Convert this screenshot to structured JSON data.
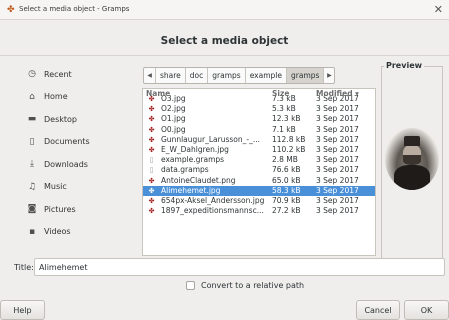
{
  "window": {
    "title": "Select a media object - Gramps",
    "heading": "Select a media object"
  },
  "sidebar": {
    "items": [
      {
        "label": "Recent",
        "icon": "clock-icon"
      },
      {
        "label": "Home",
        "icon": "home-icon"
      },
      {
        "label": "Desktop",
        "icon": "folder-icon"
      },
      {
        "label": "Documents",
        "icon": "document-icon"
      },
      {
        "label": "Downloads",
        "icon": "download-icon"
      },
      {
        "label": "Music",
        "icon": "music-icon"
      },
      {
        "label": "Pictures",
        "icon": "camera-icon"
      },
      {
        "label": "Videos",
        "icon": "video-icon"
      }
    ]
  },
  "pathbar": {
    "crumbs": [
      "share",
      "doc",
      "gramps",
      "example",
      "gramps"
    ],
    "active_index": 4
  },
  "filelist": {
    "columns": {
      "name": "Name",
      "size": "Size",
      "modified": "Modified ▾"
    },
    "rows": [
      {
        "name": "O3.jpg",
        "size": "7.3 kB",
        "modified": "3 Sep 2017",
        "type": "image"
      },
      {
        "name": "O2.jpg",
        "size": "5.3 kB",
        "modified": "3 Sep 2017",
        "type": "image"
      },
      {
        "name": "O1.jpg",
        "size": "12.3 kB",
        "modified": "3 Sep 2017",
        "type": "image"
      },
      {
        "name": "O0.jpg",
        "size": "7.1 kB",
        "modified": "3 Sep 2017",
        "type": "image"
      },
      {
        "name": "Gunnlaugur_Larusson_-_...",
        "size": "112.8 kB",
        "modified": "3 Sep 2017",
        "type": "image"
      },
      {
        "name": "E_W_Dahlgren.jpg",
        "size": "110.2 kB",
        "modified": "3 Sep 2017",
        "type": "image"
      },
      {
        "name": "example.gramps",
        "size": "2.8 MB",
        "modified": "3 Sep 2017",
        "type": "doc"
      },
      {
        "name": "data.gramps",
        "size": "76.6 kB",
        "modified": "3 Sep 2017",
        "type": "doc"
      },
      {
        "name": "AntoineClaudet.png",
        "size": "65.0 kB",
        "modified": "3 Sep 2017",
        "type": "image"
      },
      {
        "name": "Alimehemet.jpg",
        "size": "58.3 kB",
        "modified": "3 Sep 2017",
        "type": "image",
        "selected": true
      },
      {
        "name": "654px-Aksel_Andersson.jpg",
        "size": "70.9 kB",
        "modified": "3 Sep 2017",
        "type": "image"
      },
      {
        "name": "1897_expeditionsmannsc...",
        "size": "27.2 kB",
        "modified": "3 Sep 2017",
        "type": "image"
      }
    ]
  },
  "preview": {
    "label": "Preview"
  },
  "form": {
    "title_label": "Title:",
    "title_value": "Alimehemet",
    "convert_label": "Convert to a relative path"
  },
  "buttons": {
    "help": "Help",
    "cancel": "Cancel",
    "ok": "OK"
  },
  "colors": {
    "selection": "#4a90d9",
    "image_icon": "#a32020"
  }
}
